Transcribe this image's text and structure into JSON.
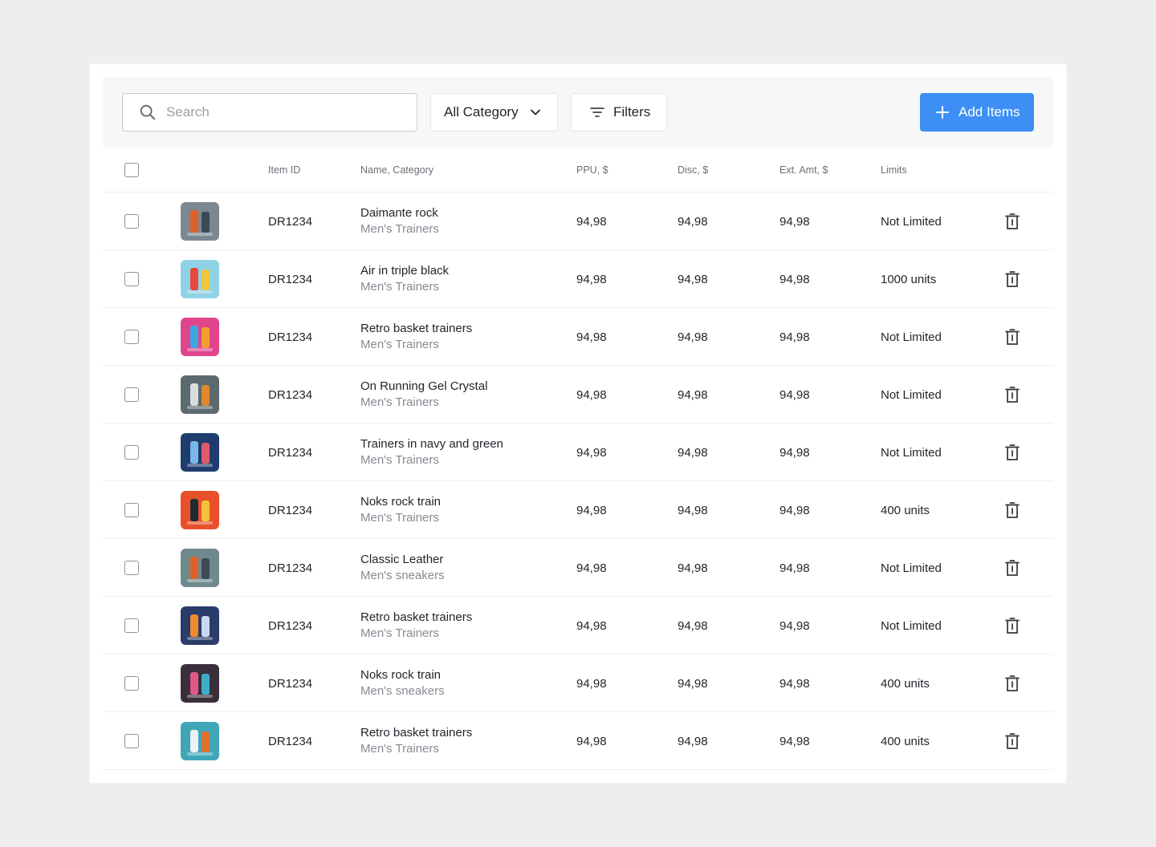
{
  "toolbar": {
    "search_placeholder": "Search",
    "category_label": "All Category",
    "filters_label": "Filters",
    "add_label": "Add Items",
    "accent_color": "#3d8ff5"
  },
  "columns": {
    "item_id": "Item ID",
    "name_category": "Name, Category",
    "ppu": "PPU, $",
    "disc": "Disc, $",
    "ext_amt": "Ext. Amt, $",
    "limits": "Limits"
  },
  "rows": [
    {
      "id": "DR1234",
      "name": "Daimante rock",
      "category": "Men's Trainers",
      "ppu": "94,98",
      "disc": "94,98",
      "ext": "94,98",
      "limits": "Not Limited",
      "thumb": "orange-can-icon",
      "colors": [
        "#7c8791",
        "#e0602a",
        "#3c4a55"
      ]
    },
    {
      "id": "DR1234",
      "name": "Air in triple black",
      "category": "Men's Trainers",
      "ppu": "94,98",
      "disc": "94,98",
      "ext": "94,98",
      "limits": "1000 units",
      "thumb": "colorful-bottles-icon",
      "colors": [
        "#8fd2e6",
        "#e8473c",
        "#f0c73a"
      ]
    },
    {
      "id": "DR1234",
      "name": "Retro basket trainers",
      "category": "Men's Trainers",
      "ppu": "94,98",
      "disc": "94,98",
      "ext": "94,98",
      "limits": "Not Limited",
      "thumb": "pink-bottles-icon",
      "colors": [
        "#e0458c",
        "#3aa7e0",
        "#f0a030"
      ]
    },
    {
      "id": "DR1234",
      "name": "On Running Gel Crystal",
      "category": "Men's Trainers",
      "ppu": "94,98",
      "disc": "94,98",
      "ext": "94,98",
      "limits": "Not Limited",
      "thumb": "robot-icon",
      "colors": [
        "#5c6a70",
        "#d9dcdc",
        "#e0892c"
      ]
    },
    {
      "id": "DR1234",
      "name": "Trainers in navy and green",
      "category": "Men's Trainers",
      "ppu": "94,98",
      "disc": "94,98",
      "ext": "94,98",
      "limits": "Not Limited",
      "thumb": "blue-sphere-icon",
      "colors": [
        "#1f3c6e",
        "#7bb6e8",
        "#e05a6a"
      ]
    },
    {
      "id": "DR1234",
      "name": "Noks rock train",
      "category": "Men's Trainers",
      "ppu": "94,98",
      "disc": "94,98",
      "ext": "94,98",
      "limits": "400 units",
      "thumb": "orange-batteries-icon",
      "colors": [
        "#e8502a",
        "#1f2a30",
        "#f2c23a"
      ]
    },
    {
      "id": "DR1234",
      "name": "Classic Leather",
      "category": "Men's sneakers",
      "ppu": "94,98",
      "disc": "94,98",
      "ext": "94,98",
      "limits": "Not Limited",
      "thumb": "orange-can-icon",
      "colors": [
        "#6f8a8c",
        "#e0602a",
        "#3c4a55"
      ]
    },
    {
      "id": "DR1234",
      "name": "Retro basket trainers",
      "category": "Men's Trainers",
      "ppu": "94,98",
      "disc": "94,98",
      "ext": "94,98",
      "limits": "Not Limited",
      "thumb": "glowing-box-icon",
      "colors": [
        "#2b3c6a",
        "#f28a2c",
        "#c7d8f0"
      ]
    },
    {
      "id": "DR1234",
      "name": "Noks rock train",
      "category": "Men's sneakers",
      "ppu": "94,98",
      "disc": "94,98",
      "ext": "94,98",
      "limits": "400 units",
      "thumb": "shopping-bags-icon",
      "colors": [
        "#3a2f3a",
        "#e0588a",
        "#3ab0c8"
      ]
    },
    {
      "id": "DR1234",
      "name": "Retro basket trainers",
      "category": "Men's Trainers",
      "ppu": "94,98",
      "disc": "94,98",
      "ext": "94,98",
      "limits": "400 units",
      "thumb": "white-device-icon",
      "colors": [
        "#3fa6b8",
        "#eef2f4",
        "#e0702c"
      ]
    }
  ]
}
